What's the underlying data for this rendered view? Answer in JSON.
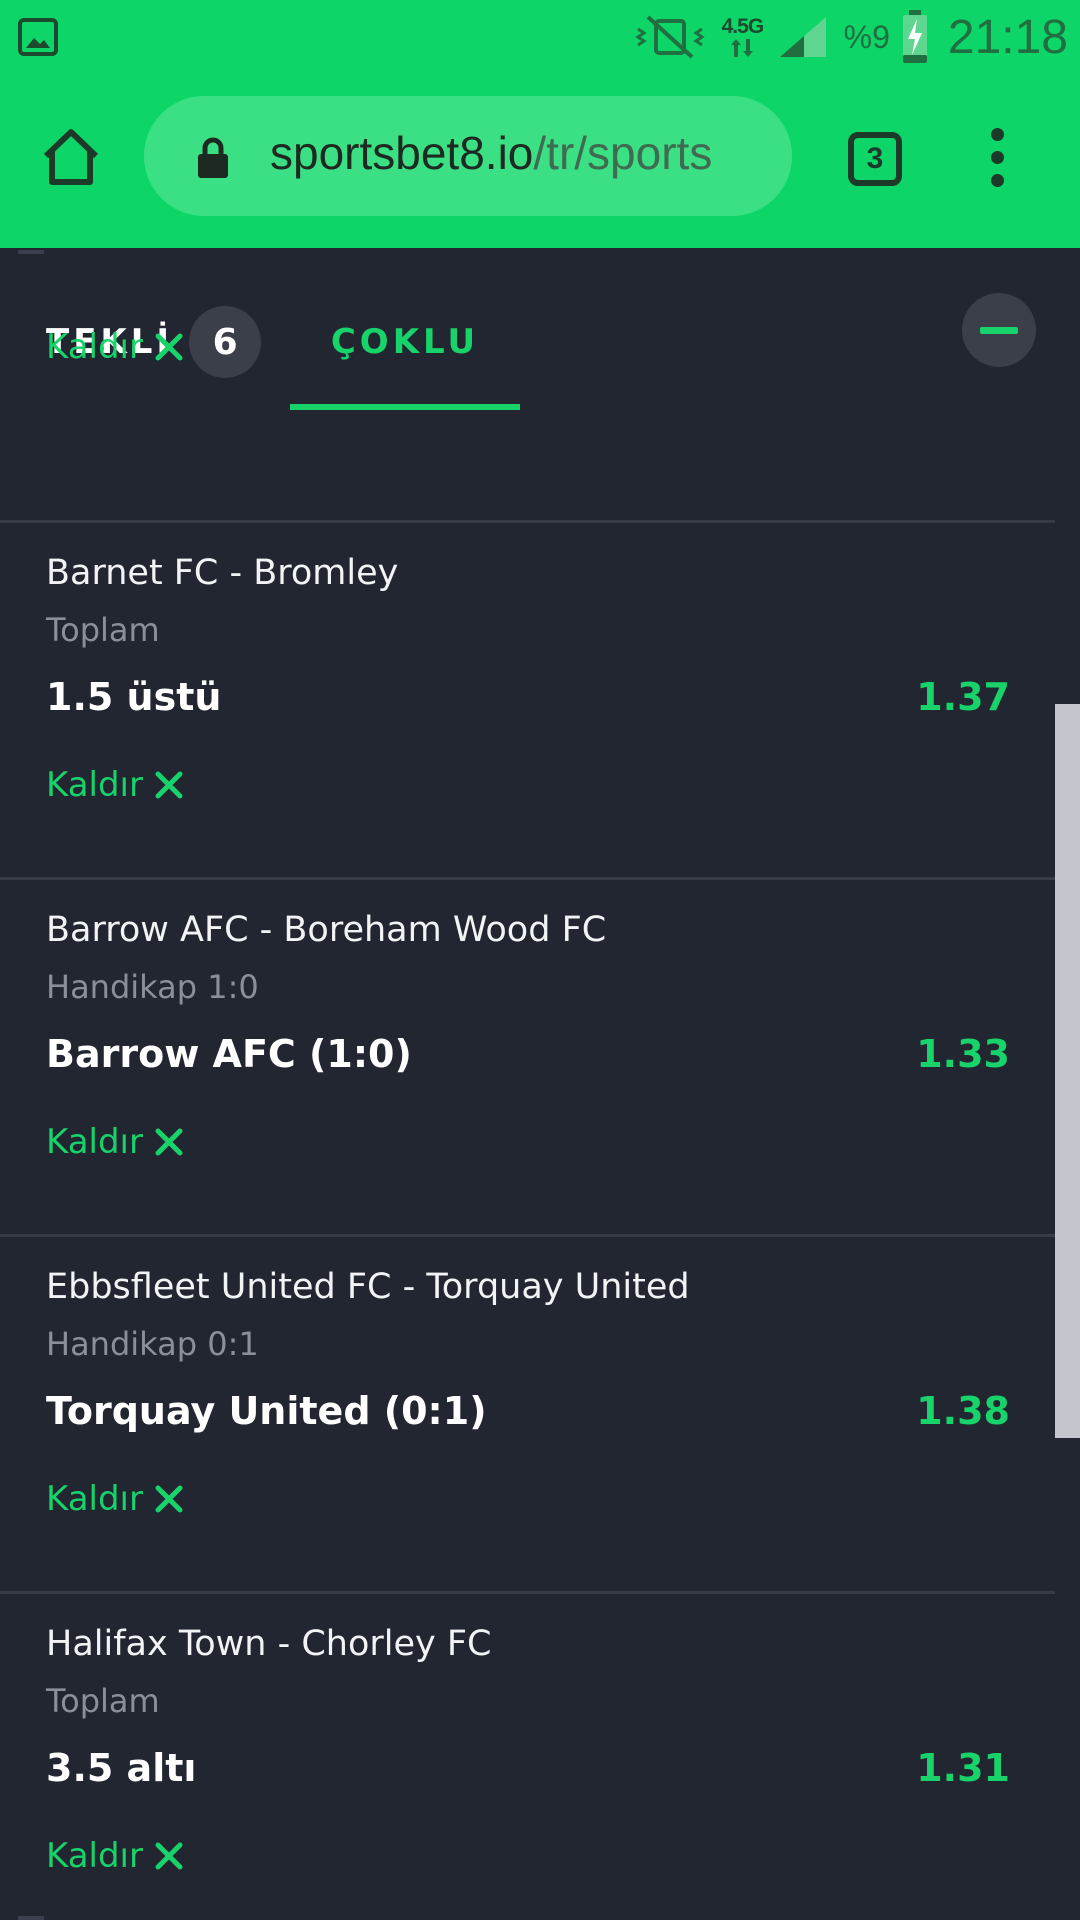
{
  "status_bar": {
    "network": "4.5G",
    "battery": "%9",
    "time": "21:18",
    "icons": [
      "gallery-icon",
      "vibrate-off-icon",
      "network-arrows-icon",
      "signal-icon",
      "battery-charging-icon"
    ]
  },
  "browser": {
    "url_host": "sportsbet8.io",
    "url_path": "/tr/sports",
    "tab_count": "3",
    "icons": [
      "home-icon",
      "lock-icon",
      "overflow-menu-icon"
    ]
  },
  "slip": {
    "tab_single": "TEKLİ",
    "single_count": "6",
    "tab_multi": "ÇOKLU",
    "active_tab": "ÇOKLU",
    "remove_label": "Kaldır",
    "bets": [
      {
        "match": "Barnet FC - Bromley",
        "market": "Toplam",
        "selection": "1.5 üstü",
        "odds": "1.37"
      },
      {
        "match": "Barrow AFC - Boreham Wood FC",
        "market": "Handikap 1:0",
        "selection": "Barrow AFC (1:0)",
        "odds": "1.33"
      },
      {
        "match": "Ebbsfleet United FC - Torquay United",
        "market": "Handikap 0:1",
        "selection": "Torquay United (0:1)",
        "odds": "1.38"
      },
      {
        "match": "Halifax Town - Chorley FC",
        "market": "Toplam",
        "selection": "3.5 altı",
        "odds": "1.31"
      }
    ]
  },
  "colors": {
    "browser_green": "#0ed567",
    "accent_green": "#18d26a",
    "background": "#212631"
  }
}
